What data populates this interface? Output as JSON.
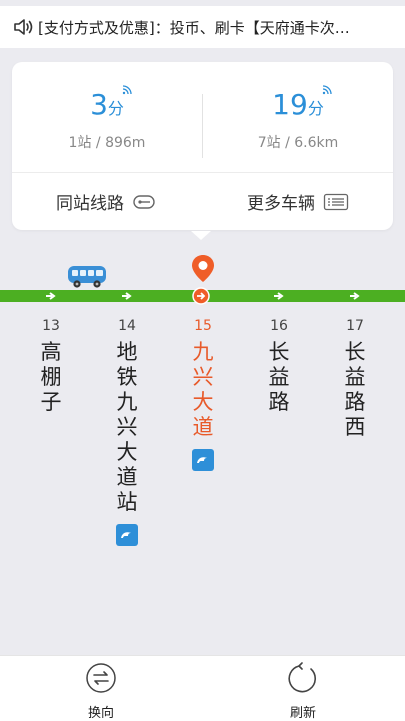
{
  "notice": {
    "icon": "speaker-icon",
    "text": "[支付方式及优惠]：投币、刷卡【天府通卡次…"
  },
  "arrivals": [
    {
      "minutes": "3",
      "unit": "分",
      "detail": "1站 / 896m"
    },
    {
      "minutes": "19",
      "unit": "分",
      "detail": "7站 / 6.6km"
    }
  ],
  "card_buttons": {
    "same_station_label": "同站线路",
    "more_vehicles_label": "更多车辆"
  },
  "stations": [
    {
      "num": "13",
      "name": "高\n棚\n子",
      "metro": false
    },
    {
      "num": "14",
      "name": "地\n铁\n九\n兴\n大\n道\n站",
      "metro": true
    },
    {
      "num": "15",
      "name": "九\n兴\n大\n道",
      "metro": true,
      "current": true
    },
    {
      "num": "16",
      "name": "长\n益\n路",
      "metro": false
    },
    {
      "num": "17",
      "name": "长\n益\n路\n西",
      "metro": false
    }
  ],
  "bottom": {
    "switch_label": "换向",
    "refresh_label": "刷新"
  },
  "colors": {
    "accent_blue": "#2b8fd8",
    "route_green": "#4caf22",
    "current_orange": "#e85a2a"
  }
}
